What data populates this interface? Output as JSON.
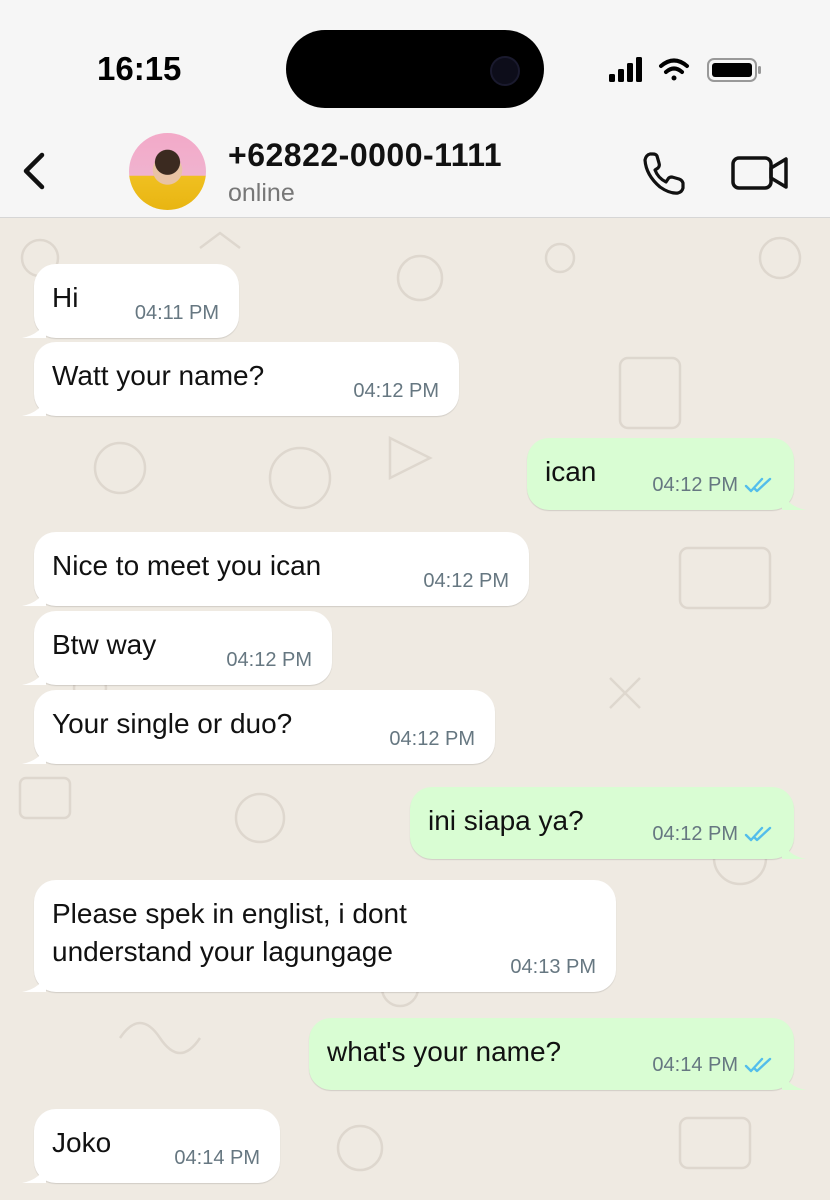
{
  "status_bar": {
    "time": "16:15"
  },
  "header": {
    "contact_name": "+62822-0000-1111",
    "contact_status": "online"
  },
  "colors": {
    "incoming": "#ffffff",
    "outgoing": "#d9fdd3",
    "tick": "#53bdeb",
    "wallpaper": "#efeae2"
  },
  "messages": [
    {
      "direction": "in",
      "text": "Hi",
      "time": "04:11 PM"
    },
    {
      "direction": "in",
      "text": "Watt your name?",
      "time": "04:12 PM"
    },
    {
      "direction": "out",
      "text": "ican",
      "time": "04:12 PM",
      "read": true
    },
    {
      "direction": "in",
      "text": "Nice to meet you ican",
      "time": "04:12 PM"
    },
    {
      "direction": "in",
      "text": "Btw way",
      "time": "04:12 PM"
    },
    {
      "direction": "in",
      "text": "Your single or duo?",
      "time": "04:12 PM"
    },
    {
      "direction": "out",
      "text": "ini siapa ya?",
      "time": "04:12 PM",
      "read": true
    },
    {
      "direction": "in",
      "text": "Please spek in englist, i dont\nunderstand your lagungage",
      "time": "04:13 PM"
    },
    {
      "direction": "out",
      "text": "what's your name?",
      "time": "04:14 PM",
      "read": true
    },
    {
      "direction": "in",
      "text": "Joko",
      "time": "04:14 PM"
    }
  ]
}
